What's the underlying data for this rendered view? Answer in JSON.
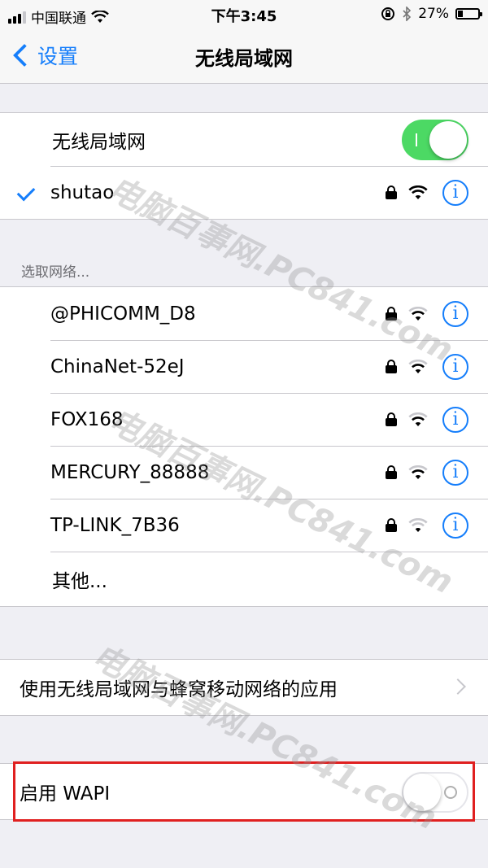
{
  "status_bar": {
    "carrier": "中国联通",
    "time": "下午3:45",
    "battery_percent": "27%",
    "battery_level": 0.27,
    "signal_bars": 3
  },
  "nav": {
    "back_label": "设置",
    "title": "无线局域网"
  },
  "wifi_toggle": {
    "label": "无线局域网",
    "on": true
  },
  "connected_network": {
    "name": "shutao"
  },
  "section_header": "选取网络...",
  "networks": [
    {
      "name": "@PHICOMM_D8"
    },
    {
      "name": "ChinaNet-52eJ"
    },
    {
      "name": "FOX168"
    },
    {
      "name": "MERCURY_88888"
    },
    {
      "name": "TP-LINK_7B36"
    }
  ],
  "other_label": "其他...",
  "apps_row": {
    "label": "使用无线局域网与蜂窝移动网络的应用"
  },
  "wapi_row": {
    "label": "启用 WAPI",
    "on": false
  },
  "watermark": "电脑百事网.PC841.com",
  "colors": {
    "accent": "#157efb",
    "toggle_on": "#4cd964",
    "highlight": "#e02020"
  }
}
